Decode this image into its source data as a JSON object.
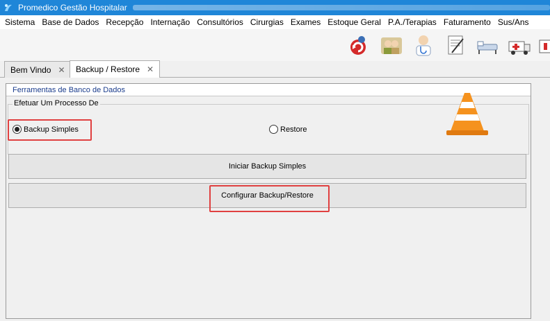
{
  "window": {
    "title": "Promedico Gestão Hospitalar"
  },
  "menu": {
    "items": [
      "Sistema",
      "Base de Dados",
      "Recepção",
      "Internação",
      "Consultórios",
      "Cirurgias",
      "Exames",
      "Estoque Geral",
      "P.A./Terapias",
      "Faturamento",
      "Sus/Ans"
    ]
  },
  "toolbar": {
    "icons": [
      "refresh-icon",
      "users-icon",
      "patients-icon",
      "doctor-icon",
      "document-edit-icon",
      "hospital-bed-icon",
      "ambulance-icon"
    ]
  },
  "tabs": [
    {
      "label": "Bem Vindo",
      "active": false
    },
    {
      "label": "Backup / Restore",
      "active": true
    }
  ],
  "panel": {
    "header": "Ferramentas de Banco de Dados",
    "group_title": "Efetuar Um Processo De",
    "options": [
      {
        "label": "Backup Simples",
        "checked": true
      },
      {
        "label": "Restore",
        "checked": false
      }
    ],
    "buttons": {
      "start": "Iniciar Backup Simples",
      "configure": "Configurar Backup/Restore"
    }
  },
  "colors": {
    "titlebar": "#1f86d8",
    "highlight": "#e04040",
    "cone": "#f5921e"
  }
}
